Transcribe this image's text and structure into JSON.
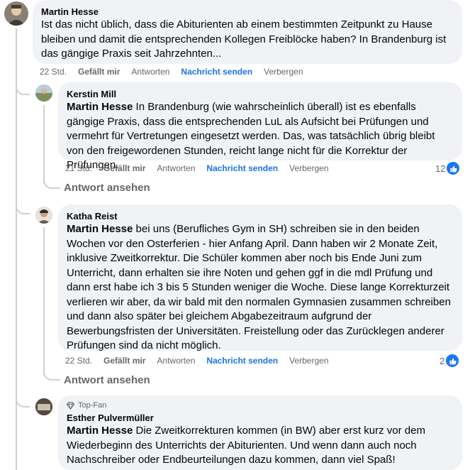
{
  "comments": [
    {
      "author": "Martin Hesse",
      "text": "Ist das nicht üblich, dass die Abiturienten ab einem bestimmten Zeitpunkt zu Hause bleiben und damit die entsprechenden Kollegen Freiblöcke haben? In Brandenburg ist das gängige Praxis seit Jahrzehnten...",
      "actions": {
        "time": "22 Std.",
        "like": "Gefällt mir",
        "reply": "Antworten",
        "message": "Nachricht senden",
        "hide": "Verbergen"
      }
    },
    {
      "author": "Kerstin Mill",
      "mention": "Martin Hesse",
      "text": " In Brandenburg (wie wahrscheinlich überall) ist es ebenfalls gängige Praxis, dass die entsprechenden LuL als Aufsicht bei Prüfungen und vermehrt für Vertretungen eingesetzt werden. Das, was tatsächlich übrig bleibt von den freigewordenen Stunden, reicht lange nicht für die Korrektur der Prüfungen.",
      "actions": {
        "time": "21 Std.",
        "like": "Gefällt mir",
        "reply": "Antworten",
        "message": "Nachricht senden",
        "hide": "Verbergen"
      },
      "reaction_count": "12",
      "see_replies": "Antwort ansehen"
    },
    {
      "author": "Katha Reist",
      "mention": "Martin Hesse",
      "text": " bei uns (Berufliches Gym in SH) schreiben sie in den beiden Wochen vor den Osterferien - hier Anfang April. Dann haben wir 2 Monate Zeit, inklusive Zweitkorrektur. Die Schüler kommen aber noch bis Ende Juni zum Unterricht, dann erhalten sie ihre Noten und gehen ggf in die mdl Prüfung und dann erst habe ich 3 bis 5 Stunden weniger die Woche. Diese lange Korrekturzeit verlieren wir aber, da wir bald mit den normalen Gymnasien zusammen schreiben und dann also später bei gleichem Abgabezeitraum aufgrund der Bewerbungsfristen der Universitäten. Freistellung oder das Zurücklegen anderer Prüfungen sind da nicht möglich.",
      "actions": {
        "time": "22 Std.",
        "like": "Gefällt mir",
        "reply": "Antworten",
        "message": "Nachricht senden",
        "hide": "Verbergen"
      },
      "reaction_count": "2",
      "see_replies": "Antwort ansehen"
    },
    {
      "badge": "Top-Fan",
      "author": "Esther Pulvermüller",
      "mention": "Martin Hesse",
      "text": " Die Zweitkorrekturen kommen (in BW) aber erst kurz vor dem Wiederbeginn des Unterrichts der Abiturienten. Und wenn dann auch noch Nachschreiber oder Endbeurteilungen dazu kommen, dann viel Spaß!"
    }
  ],
  "colors": {
    "accent": "#1877f2",
    "message_link": "#1b74e4",
    "bubble": "#f0f2f5",
    "meta": "#65676b"
  }
}
